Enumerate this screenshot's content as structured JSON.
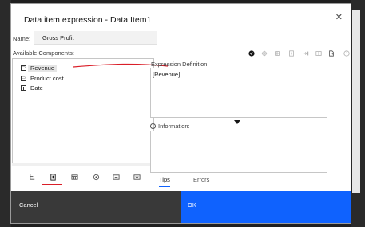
{
  "dialog": {
    "title": "Data item expression - Data Item1",
    "close_symbol": "✕"
  },
  "name": {
    "label": "Name:",
    "value": "Gross Profit"
  },
  "components": {
    "label": "Available Components:",
    "items": [
      {
        "label": "Revenue",
        "icon": "measure-icon"
      },
      {
        "label": "Product cost",
        "icon": "measure-icon"
      },
      {
        "label": "Date",
        "icon": "dimension-icon"
      }
    ]
  },
  "expression": {
    "label": "Expression Definition:",
    "value": "[Revenue]"
  },
  "information": {
    "label": "Information:"
  },
  "tabs": [
    {
      "label": "Tips",
      "active": true
    },
    {
      "label": "Errors",
      "active": false
    }
  ],
  "footer": {
    "cancel": "Cancel",
    "ok": "OK"
  },
  "colors": {
    "primary": "#0f62fe",
    "secondary_button": "#393939",
    "annotation_red": "#da1e28"
  }
}
